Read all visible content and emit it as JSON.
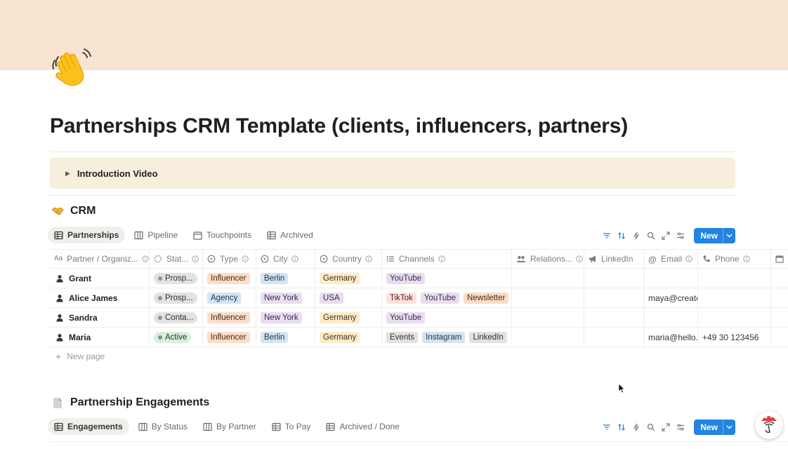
{
  "page": {
    "title": "Partnerships CRM Template (clients, influencers, partners)",
    "icon": "waving-hand-icon",
    "cover_color": "#f9e3d1"
  },
  "callout": {
    "label": "Introduction Video",
    "bg": "#f7eedd"
  },
  "crm": {
    "title": "CRM",
    "icon": "handshake-icon",
    "tabs": [
      {
        "label": "Partnerships",
        "icon": "table-icon",
        "active": true
      },
      {
        "label": "Pipeline",
        "icon": "board-icon",
        "active": false
      },
      {
        "label": "Touchpoints",
        "icon": "calendar-icon",
        "active": false
      },
      {
        "label": "Archived",
        "icon": "table-icon",
        "active": false
      }
    ],
    "new_label": "New",
    "columns": [
      "Partner / Organiz...",
      "Stat...",
      "Type",
      "City",
      "Country",
      "Channels",
      "Relations...",
      "LinkedIn",
      "Email",
      "Phone"
    ],
    "rows": [
      {
        "name": "Grant",
        "status": "Prosp...",
        "status_color": "gray",
        "type": "Influencer",
        "city": "Berlin",
        "country": "Germany",
        "channels": [
          {
            "label": "YouTube",
            "color": "purple"
          }
        ],
        "email": "",
        "phone": ""
      },
      {
        "name": "Alice James",
        "status": "Prosp...",
        "status_color": "gray",
        "type": "Agency",
        "city": "New York",
        "country": "USA",
        "channels": [
          {
            "label": "TikTok",
            "color": "red"
          },
          {
            "label": "YouTube",
            "color": "purple"
          },
          {
            "label": "Newsletter",
            "color": "orange"
          }
        ],
        "email": "maya@creator",
        "phone": ""
      },
      {
        "name": "Sandra",
        "status": "Conta...",
        "status_color": "gray",
        "type": "Influencer",
        "city": "New York",
        "country": "Germany",
        "channels": [
          {
            "label": "YouTube",
            "color": "purple"
          }
        ],
        "email": "",
        "phone": ""
      },
      {
        "name": "Maria",
        "status": "Active",
        "status_color": "green",
        "type": "Influencer",
        "city": "Berlin",
        "country": "Germany",
        "channels": [
          {
            "label": "Events",
            "color": "gray"
          },
          {
            "label": "Instagram",
            "color": "blue"
          },
          {
            "label": "LinkedIn",
            "color": "gray"
          }
        ],
        "email": "maria@hello.co",
        "phone": "+49 30 123456"
      }
    ],
    "new_page_label": "New page"
  },
  "engagements": {
    "title": "Partnership Engagements",
    "icon": "document-icon",
    "tabs": [
      {
        "label": "Engagements",
        "icon": "table-icon",
        "active": true
      },
      {
        "label": "By Status",
        "icon": "board-icon",
        "active": false
      },
      {
        "label": "By Partner",
        "icon": "board-icon",
        "active": false
      },
      {
        "label": "To Pay",
        "icon": "table-icon",
        "active": false
      },
      {
        "label": "Archived / Done",
        "icon": "table-icon",
        "active": false
      }
    ],
    "new_label": "New"
  },
  "colors": {
    "accent": "#2383e2",
    "tag_orange": "#fadec9",
    "tag_blue": "#d3e5ef",
    "tag_yellow": "#fdecc8",
    "tag_purple": "#e8deee",
    "tag_red": "#ffe2dd",
    "tag_gray": "#e3e2e0",
    "status_green": "#dbeddb"
  }
}
